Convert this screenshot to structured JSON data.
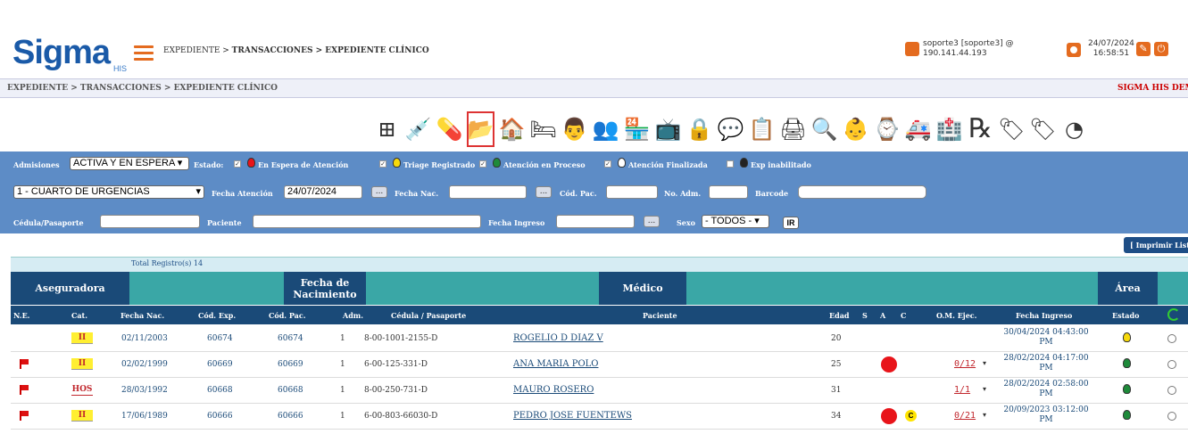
{
  "header": {
    "logo_text": "Sigma",
    "logo_sub": "HIS",
    "breadcrumb_a": "EXPEDIENTE > ",
    "breadcrumb_b": "TRANSACCIONES > EXPEDIENTE CLÍNICO",
    "user_line1": "soporte3 [soporte3] @",
    "user_line2": "190.141.44.193",
    "date": "24/07/2024",
    "time": "16:58:51"
  },
  "subbar": {
    "breadcrumb": "EXPEDIENTE > TRANSACCIONES > EXPEDIENTE CLÍNICO",
    "brand": "SIGMA HIS DEM"
  },
  "toolbar": {
    "icons": [
      "org-chart-icon",
      "vaccine-icon",
      "pill-icon",
      "new-folder-icon",
      "home-basket-icon",
      "bed-transfer-icon",
      "doctor-icon",
      "team-icon",
      "home-cart-icon",
      "monitor-icon",
      "lock-icon",
      "chat-icon",
      "checklist-icon",
      "printer-icon",
      "scan-icon",
      "baby-icon",
      "wristband-icon",
      "ambulance-icon",
      "home-alert-icon",
      "prescription-icon",
      "tag-icon",
      "tag2-icon",
      "gauge-icon"
    ],
    "selected_index": 3
  },
  "filters": {
    "admisiones_label": "Admisiones",
    "admisiones_value": "ACTIVA Y EN ESPERA",
    "estado_label": "Estado:",
    "status": [
      {
        "label": "En Espera de Atención",
        "color": "#e8141a",
        "checked": true
      },
      {
        "label": "Triage Registrado",
        "color": "#f7d90a",
        "checked": true
      },
      {
        "label": "Atención en Proceso",
        "color": "#1e8a3a",
        "checked": true
      },
      {
        "label": "Atención Finalizada",
        "color": "#ffffff",
        "checked": true
      },
      {
        "label": "Exp inabilitado",
        "color": "#222222",
        "checked": false
      }
    ],
    "area_value": "1 - CUARTO DE URGENCIAS",
    "fecha_atencion_label": "Fecha Atención",
    "fecha_atencion_value": "24/07/2024",
    "fecha_nac_label": "Fecha Nac.",
    "cod_pac_label": "Cód. Pac.",
    "no_adm_label": "No. Adm.",
    "barcode_label": "Barcode",
    "cedula_label": "Cédula/Pasaporte",
    "paciente_label": "Paciente",
    "fecha_ingreso_label": "Fecha Ingreso",
    "sexo_label": "Sexo",
    "sexo_value": "- TODOS -",
    "ir_label": "IR",
    "ellipsis": "...",
    "print_label": "[ Imprimir Lista"
  },
  "table": {
    "total": "Total Registro(s) 14",
    "groups": {
      "aseguradora": "Aseguradora",
      "fecha_nac": "Fecha de Nacimiento",
      "medico": "Médico",
      "area": "Área"
    },
    "columns": [
      "N.E.",
      "Cat.",
      "Fecha Nac.",
      "Cód. Exp.",
      "Cód. Pac.",
      "Adm.",
      "Cédula / Pasaporte",
      "Paciente",
      "Edad",
      "S",
      "A",
      "C",
      "O.M. Ejec.",
      "Fecha Ingreso",
      "Estado"
    ],
    "rows": [
      {
        "flag": false,
        "cat": "II",
        "fecha_nac": "02/11/2003",
        "cod_exp": "60674",
        "cod_pac": "60674",
        "adm": "1",
        "cedula": "8-00-1001-2155-D",
        "paciente": "ROGELIO D DIAZ V",
        "edad": "20",
        "a": false,
        "c": false,
        "om": "",
        "ingreso1": "30/04/2024 04:43:00",
        "ingreso2": "PM",
        "estado": "#f7d90a"
      },
      {
        "flag": true,
        "cat": "II",
        "fecha_nac": "02/02/1999",
        "cod_exp": "60669",
        "cod_pac": "60669",
        "adm": "1",
        "cedula": "6-00-125-331-D",
        "paciente": "ANA MARIA POLO",
        "edad": "25",
        "a": true,
        "c": false,
        "om": "0/12",
        "ingreso1": "28/02/2024 04:17:00",
        "ingreso2": "PM",
        "estado": "#1e8a3a"
      },
      {
        "flag": true,
        "cat": "HOS",
        "fecha_nac": "28/03/1992",
        "cod_exp": "60668",
        "cod_pac": "60668",
        "adm": "1",
        "cedula": "8-00-250-731-D",
        "paciente": "MAURO ROSERO",
        "edad": "31",
        "a": false,
        "c": false,
        "om": "1/1",
        "ingreso1": "28/02/2024 02:58:00",
        "ingreso2": "PM",
        "estado": "#1e8a3a"
      },
      {
        "flag": true,
        "cat": "II",
        "fecha_nac": "17/06/1989",
        "cod_exp": "60666",
        "cod_pac": "60666",
        "adm": "1",
        "cedula": "6-00-803-66030-D",
        "paciente": "PEDRO JOSE FUENTEWS",
        "edad": "34",
        "a": true,
        "c": true,
        "om": "0/21",
        "ingreso1": "20/09/2023 03:12:00",
        "ingreso2": "PM",
        "estado": "#1e8a3a"
      }
    ],
    "c_badge": "C"
  }
}
